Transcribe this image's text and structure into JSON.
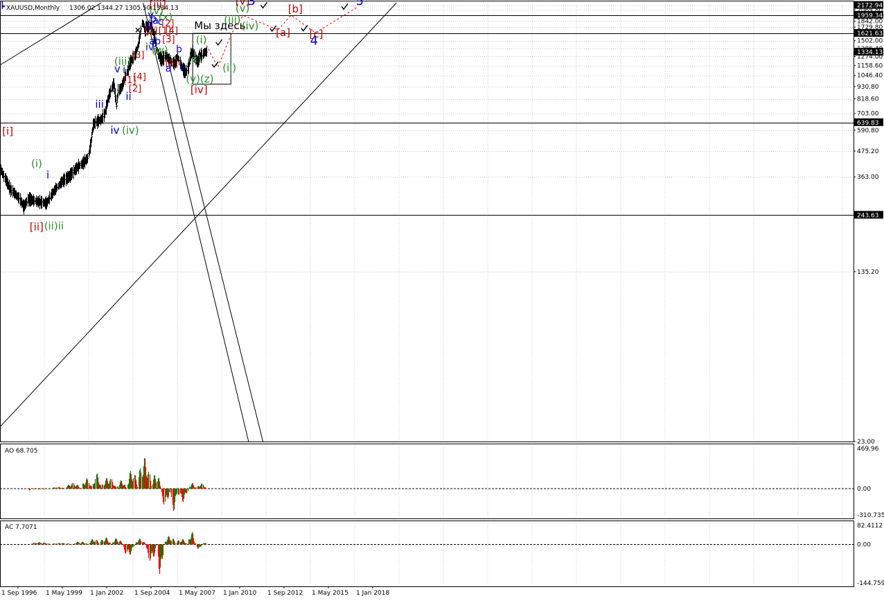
{
  "chart_data": {
    "type": "candlestick",
    "symbol_header": "XAUUSD,Monthly",
    "ohlc_header": "1306.02 1344.27 1305.50 1334.13",
    "price_axis": {
      "scale": "log",
      "range": [
        23.0,
        2230.0
      ],
      "ticks": [
        "2172.94",
        "2069.80",
        "1842.00",
        "1729.80",
        "1621.63",
        "1502.00",
        "1386.40",
        "1274.00",
        "1158.60",
        "1046.40",
        "930.80",
        "818.60",
        "703.00",
        "590.80",
        "475.20",
        "363.00",
        "243.63",
        "135.20",
        "23.00"
      ],
      "highlight_labels": [
        "2172.94",
        "1959.34",
        "1621.63",
        "1334.13",
        "639.83",
        "243.63"
      ]
    },
    "time_axis": {
      "labels": [
        "1 Sep 1996",
        "1 May 1999",
        "1 Jan 2002",
        "1 Sep 2004",
        "1 May 2007",
        "1 Jan 2010",
        "1 Sep 2012",
        "1 May 2015",
        "1 Jan 2018"
      ]
    },
    "horizontal_levels": [
      1959.34,
      1621.63,
      639.83,
      243.63
    ],
    "price_path": [
      {
        "m": 0,
        "p": 390
      },
      {
        "m": 12,
        "p": 320
      },
      {
        "m": 24,
        "p": 290
      },
      {
        "m": 30,
        "p": 265
      },
      {
        "m": 36,
        "p": 288
      },
      {
        "m": 48,
        "p": 280
      },
      {
        "m": 54,
        "p": 278
      },
      {
        "m": 60,
        "p": 275
      },
      {
        "m": 66,
        "p": 300
      },
      {
        "m": 72,
        "p": 320
      },
      {
        "m": 80,
        "p": 345
      },
      {
        "m": 90,
        "p": 365
      },
      {
        "m": 100,
        "p": 400
      },
      {
        "m": 108,
        "p": 420
      },
      {
        "m": 114,
        "p": 440
      },
      {
        "m": 118,
        "p": 520
      },
      {
        "m": 121,
        "p": 620
      },
      {
        "m": 124,
        "p": 640
      },
      {
        "m": 132,
        "p": 660
      },
      {
        "m": 136,
        "p": 700
      },
      {
        "m": 140,
        "p": 800
      },
      {
        "m": 146,
        "p": 930
      },
      {
        "m": 148,
        "p": 960
      },
      {
        "m": 150,
        "p": 850
      },
      {
        "m": 152,
        "p": 760
      },
      {
        "m": 154,
        "p": 890
      },
      {
        "m": 158,
        "p": 920
      },
      {
        "m": 162,
        "p": 1000
      },
      {
        "m": 166,
        "p": 1100
      },
      {
        "m": 170,
        "p": 1200
      },
      {
        "m": 174,
        "p": 1260
      },
      {
        "m": 176,
        "p": 1300
      },
      {
        "m": 178,
        "p": 1360
      },
      {
        "m": 180,
        "p": 1420
      },
      {
        "m": 183,
        "p": 1600
      },
      {
        "m": 185,
        "p": 1800
      },
      {
        "m": 187,
        "p": 1780
      },
      {
        "m": 189,
        "p": 1650
      },
      {
        "m": 191,
        "p": 1750
      },
      {
        "m": 193,
        "p": 1700
      },
      {
        "m": 195,
        "p": 1780
      },
      {
        "m": 198,
        "p": 1700
      },
      {
        "m": 201,
        "p": 1600
      },
      {
        "m": 204,
        "p": 1400
      },
      {
        "m": 206,
        "p": 1300
      },
      {
        "m": 209,
        "p": 1250
      },
      {
        "m": 212,
        "p": 1230
      },
      {
        "m": 216,
        "p": 1280
      },
      {
        "m": 220,
        "p": 1250
      },
      {
        "m": 224,
        "p": 1200
      },
      {
        "m": 228,
        "p": 1180
      },
      {
        "m": 232,
        "p": 1270
      },
      {
        "m": 236,
        "p": 1170
      },
      {
        "m": 240,
        "p": 1100
      },
      {
        "m": 243,
        "p": 1080
      },
      {
        "m": 246,
        "p": 1150
      },
      {
        "m": 249,
        "p": 1300
      },
      {
        "m": 252,
        "p": 1330
      },
      {
        "m": 255,
        "p": 1250
      },
      {
        "m": 258,
        "p": 1200
      },
      {
        "m": 261,
        "p": 1280
      },
      {
        "m": 264,
        "p": 1290
      },
      {
        "m": 267,
        "p": 1330
      },
      {
        "m": 270,
        "p": 1334
      }
    ],
    "rect": {
      "m0": 252,
      "m1": 302,
      "p_high": 1621.63,
      "p_low": 955
    },
    "rect_label": "Мы здесь.",
    "trend_lines": [
      {
        "m0": 0,
        "p0": 1170,
        "m1": 280,
        "p1": 4600
      },
      {
        "m0": 0,
        "p0": 27,
        "m1": 594,
        "p1": 4200
      },
      {
        "m0": 165,
        "p0": 4600,
        "m1": 328,
        "p1": 21
      },
      {
        "m0": 216,
        "p0": 1360,
        "m1": 347,
        "p1": 21
      }
    ],
    "forecast_path": [
      {
        "m": 270,
        "p": 1430
      },
      {
        "m": 285,
        "p": 1140
      },
      {
        "m": 303,
        "p": 1621.63
      },
      {
        "m": 318,
        "p": 1955
      },
      {
        "m": 364,
        "p": 1680
      },
      {
        "m": 381,
        "p": 1960
      },
      {
        "m": 413,
        "p": 1630
      },
      {
        "m": 467,
        "p": 2120
      }
    ],
    "checks": [
      {
        "m": 286,
        "p": 1468
      },
      {
        "m": 281,
        "p": 1165
      },
      {
        "m": 345,
        "p": 2160
      },
      {
        "m": 357,
        "p": 1695
      },
      {
        "m": 398,
        "p": 1700
      },
      {
        "m": 451,
        "p": 2130
      }
    ],
    "x_marks": [
      {
        "m": 180,
        "p": 1678
      },
      {
        "m": 202,
        "p": 1640
      }
    ],
    "wave_labels": [
      {
        "t": "[iii]",
        "c": "#c00000",
        "m": 195,
        "p": 2110,
        "size": 15
      },
      {
        "t": "(v)",
        "c": "#2e8b2e",
        "m": 195,
        "p": 1980,
        "size": 15
      },
      {
        "t": "v",
        "c": "#0000cc",
        "m": 193,
        "p": 1895,
        "size": 15
      },
      {
        "t": "(x)",
        "c": "#2e8b2e",
        "m": 207,
        "p": 1852,
        "size": 15
      },
      {
        "t": "b",
        "c": "#0000cc",
        "m": 196,
        "p": 1820,
        "size": 15
      },
      {
        "t": "a",
        "c": "#0000cc",
        "m": 199,
        "p": 1790,
        "size": 15
      },
      {
        "t": "c",
        "c": "#0000cc",
        "m": 206,
        "p": 1770,
        "size": 15
      },
      {
        "t": "[2]",
        "c": "#c00000",
        "m": 211,
        "p": 1745,
        "size": 13
      },
      {
        "t": "iii",
        "c": "#0000cc",
        "m": 189,
        "p": 1680,
        "size": 14
      },
      {
        "t": "[5]",
        "c": "#c00000",
        "m": 189,
        "p": 1615,
        "size": 13
      },
      {
        "t": "[1]",
        "c": "#c00000",
        "m": 207,
        "p": 1615,
        "size": 13
      },
      {
        "t": "[4]",
        "c": "#c00000",
        "m": 216,
        "p": 1615,
        "size": 13
      },
      {
        "t": "[3]",
        "c": "#c00000",
        "m": 212,
        "p": 1475,
        "size": 13
      },
      {
        "t": "a",
        "c": "#0000cc",
        "m": 195,
        "p": 1445,
        "size": 14
      },
      {
        "t": "b",
        "c": "#0000cc",
        "m": 202,
        "p": 1445,
        "size": 14
      },
      {
        "t": "c",
        "c": "#0000cc",
        "m": 198,
        "p": 1410,
        "size": 14
      },
      {
        "t": "iv",
        "c": "#0000cc",
        "m": 190,
        "p": 1360,
        "size": 14
      },
      {
        "t": "(w)",
        "c": "#2e8b2e",
        "m": 198,
        "p": 1310,
        "size": 15
      },
      {
        "t": "b",
        "c": "#0000cc",
        "m": 230,
        "p": 1330,
        "size": 14
      },
      {
        "t": "[5]",
        "c": "#c00000",
        "m": 216,
        "p": 1150,
        "size": 13
      },
      {
        "t": "a",
        "c": "#0000cc",
        "m": 216,
        "p": 1085,
        "size": 15
      },
      {
        "t": "c",
        "c": "#0000cc",
        "m": 235,
        "p": 1090,
        "size": 15
      },
      {
        "t": "(x)",
        "c": "#2e8b2e",
        "m": 246,
        "p": 1200,
        "size": 14
      },
      {
        "t": "(y)(z)",
        "c": "#2e8b2e",
        "m": 243,
        "p": 970,
        "size": 15
      },
      {
        "t": "[iv]",
        "c": "#c00000",
        "m": 249,
        "p": 870,
        "size": 15
      },
      {
        "t": "(i)",
        "c": "#2e8b2e",
        "m": 256,
        "p": 1460,
        "size": 15
      },
      {
        "t": "(ii)",
        "c": "#2e8b2e",
        "m": 291,
        "p": 1090,
        "size": 15
      },
      {
        "t": "[3]",
        "c": "#c00000",
        "m": 172,
        "p": 1255,
        "size": 13
      },
      {
        "t": "(iii)",
        "c": "#2e8b2e",
        "m": 149,
        "p": 1170,
        "size": 15
      },
      {
        "t": "v",
        "c": "#0000cc",
        "m": 149,
        "p": 1080,
        "size": 15
      },
      {
        "t": "i",
        "c": "#0000cc",
        "m": 160,
        "p": 1070,
        "size": 15
      },
      {
        "t": "[4]",
        "c": "#c00000",
        "m": 174,
        "p": 1000,
        "size": 13
      },
      {
        "t": "[1]",
        "c": "#c00000",
        "m": 161,
        "p": 965,
        "size": 13
      },
      {
        "t": "[2]",
        "c": "#c00000",
        "m": 168,
        "p": 885,
        "size": 13
      },
      {
        "t": "ii",
        "c": "#0000cc",
        "m": 164,
        "p": 810,
        "size": 15
      },
      {
        "t": "iii",
        "c": "#0000cc",
        "m": 124,
        "p": 745,
        "size": 15
      },
      {
        "t": "iv",
        "c": "#0000cc",
        "m": 144,
        "p": 570,
        "size": 15
      },
      {
        "t": "(iv)",
        "c": "#2e8b2e",
        "m": 159,
        "p": 570,
        "size": 15
      },
      {
        "t": "[i]",
        "c": "#c00000",
        "m": 2,
        "p": 562,
        "size": 15
      },
      {
        "t": "(i)",
        "c": "#2e8b2e",
        "m": 40,
        "p": 402,
        "size": 15
      },
      {
        "t": "i",
        "c": "#0000cc",
        "m": 60,
        "p": 357,
        "size": 15
      },
      {
        "t": "[ii]",
        "c": "#c00000",
        "m": 38,
        "p": 208,
        "size": 15
      },
      {
        "t": "(ii)ii",
        "c": "#2e8b2e",
        "m": 57,
        "p": 210,
        "size": 15
      },
      {
        "t": "[v]",
        "c": "#c00000",
        "m": 308,
        "p": 2190,
        "size": 15
      },
      {
        "t": "3",
        "c": "#0000cc",
        "m": 324,
        "p": 2180,
        "size": 18
      },
      {
        "t": "(v)",
        "c": "#2e8b2e",
        "m": 308,
        "p": 2030,
        "size": 15
      },
      {
        "t": "[b]",
        "c": "#c00000",
        "m": 377,
        "p": 2015,
        "size": 15
      },
      {
        "t": "(iii)",
        "c": "#2e8b2e",
        "m": 293,
        "p": 1800,
        "size": 15
      },
      {
        "t": "(iv)",
        "c": "#2e8b2e",
        "m": 316,
        "p": 1690,
        "size": 15
      },
      {
        "t": "[a]",
        "c": "#c00000",
        "m": 361,
        "p": 1575,
        "size": 15
      },
      {
        "t": "[c]",
        "c": "#c00000",
        "m": 405,
        "p": 1555,
        "size": 15
      },
      {
        "t": "4",
        "c": "#0000cc",
        "m": 406,
        "p": 1440,
        "size": 18
      },
      {
        "t": "5",
        "c": "#0000cc",
        "m": 466,
        "p": 2180,
        "size": 18
      },
      {
        "t": "l",
        "c": "#0000cc",
        "m": 0,
        "p": 2090,
        "size": 16
      }
    ],
    "ao": {
      "label": "AO 68.705",
      "ticks": [
        "469.96",
        "0.00",
        "-310.735"
      ],
      "range": [
        -310.735,
        469.96
      ],
      "series": [
        {
          "m0": 36,
          "m1": 39,
          "v": -20
        },
        {
          "m0": 40,
          "m1": 66,
          "v": -8
        },
        {
          "m0": 67,
          "m1": 85,
          "v": 18
        },
        {
          "m0": 86,
          "m1": 106,
          "v": 60
        },
        {
          "m0": 107,
          "m1": 120,
          "v": 110
        },
        {
          "m0": 121,
          "m1": 132,
          "v": 160
        },
        {
          "m0": 133,
          "m1": 152,
          "v": 120
        },
        {
          "m0": 153,
          "m1": 165,
          "v": 90
        },
        {
          "m0": 166,
          "m1": 180,
          "v": 200
        },
        {
          "m0": 181,
          "m1": 198,
          "v": 330
        },
        {
          "m0": 199,
          "m1": 210,
          "v": 170
        },
        {
          "m0": 211,
          "m1": 222,
          "v": -180
        },
        {
          "m0": 223,
          "m1": 232,
          "v": -240
        },
        {
          "m0": 233,
          "m1": 246,
          "v": -140
        },
        {
          "m0": 247,
          "m1": 257,
          "v": 60
        },
        {
          "m0": 258,
          "m1": 270,
          "v": 55
        }
      ]
    },
    "ac": {
      "label": "AC 7.7071",
      "ticks": [
        "82.4112",
        "0.00",
        "-144.7594"
      ],
      "range": [
        -144.7594,
        82.4112
      ],
      "series": [
        {
          "m0": 40,
          "m1": 66,
          "v": 8
        },
        {
          "m0": 67,
          "m1": 95,
          "v": 5
        },
        {
          "m0": 96,
          "m1": 115,
          "v": 10
        },
        {
          "m0": 116,
          "m1": 130,
          "v": 20
        },
        {
          "m0": 131,
          "m1": 145,
          "v": 25
        },
        {
          "m0": 146,
          "m1": 160,
          "v": 22
        },
        {
          "m0": 161,
          "m1": 176,
          "v": -40
        },
        {
          "m0": 177,
          "m1": 190,
          "v": 20
        },
        {
          "m0": 191,
          "m1": 205,
          "v": -60
        },
        {
          "m0": 206,
          "m1": 214,
          "v": -120
        },
        {
          "m0": 215,
          "m1": 230,
          "v": 30
        },
        {
          "m0": 231,
          "m1": 245,
          "v": 20
        },
        {
          "m0": 246,
          "m1": 256,
          "v": 45
        },
        {
          "m0": 257,
          "m1": 264,
          "v": -20
        },
        {
          "m0": 265,
          "m1": 270,
          "v": 10
        }
      ]
    },
    "colors": {
      "green": "#008000",
      "red": "#ff0000",
      "grid": "#c8c8c8",
      "price_tag_bg": "#000000"
    }
  }
}
